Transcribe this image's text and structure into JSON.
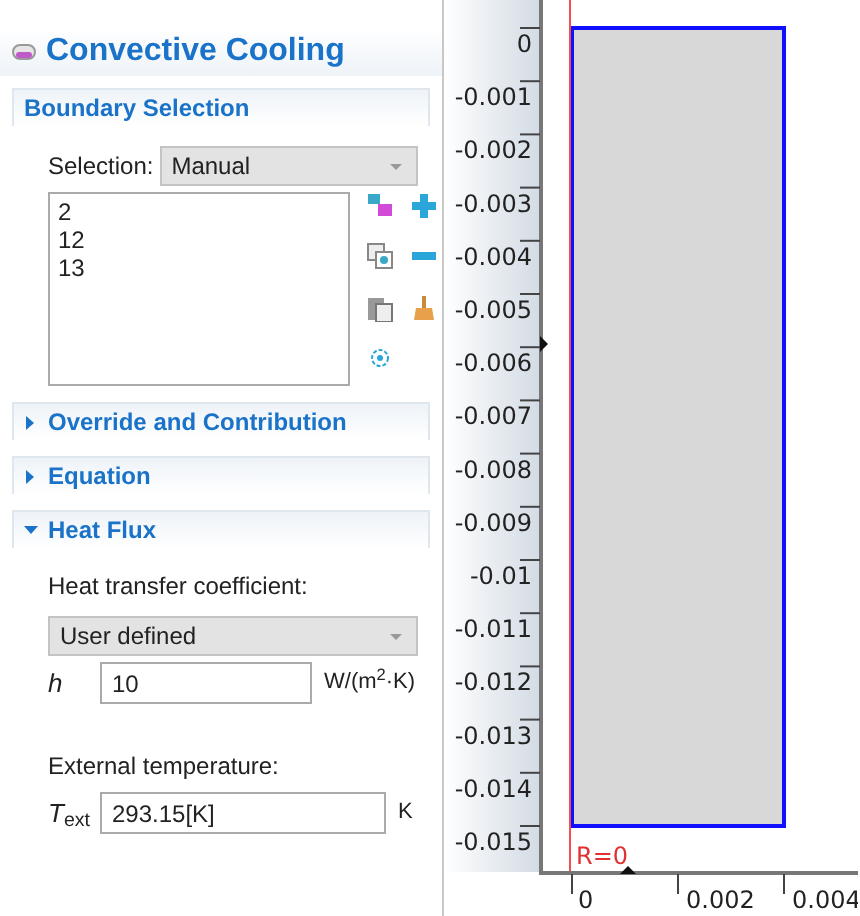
{
  "settings": {
    "title": "Convective Cooling",
    "boundary_selection": {
      "title": "Boundary Selection",
      "selection_label": "Selection:",
      "selection_value": "Manual",
      "items": [
        "2",
        "12",
        "13"
      ]
    },
    "sections": [
      {
        "title": "Override and Contribution",
        "expanded": false
      },
      {
        "title": "Equation",
        "expanded": false
      },
      {
        "title": "Heat Flux",
        "expanded": true
      }
    ],
    "heat_flux": {
      "coefficient_label": "Heat transfer coefficient:",
      "coefficient_type": "User defined",
      "fields": [
        {
          "symbol": "h",
          "kind": "italic",
          "value": "10",
          "unit": "W/(m$^{2}$·K)"
        }
      ],
      "temperature_label": "External temperature:",
      "temperature_field": {
        "symbol": "*T*$_{ext}$",
        "kind": "rich",
        "value": "293.15[K]",
        "unit": "K"
      }
    }
  },
  "graphics": {
    "y_ticks": [
      "0",
      "-0.001",
      "-0.002",
      "-0.003",
      "-0.004",
      "-0.005",
      "-0.006",
      "-0.007",
      "-0.008",
      "-0.009",
      "-0.01",
      "-0.011",
      "-0.012",
      "-0.013",
      "-0.014",
      "-0.015"
    ],
    "x_ticks": [
      "0",
      "0.002",
      "0.004"
    ],
    "axis_label": "R=0"
  }
}
